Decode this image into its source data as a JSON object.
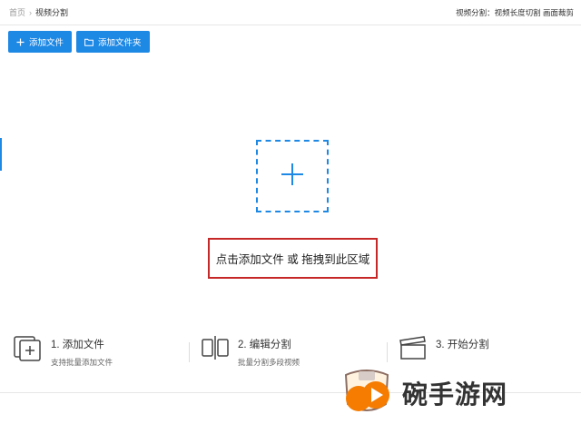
{
  "breadcrumb": {
    "home": "首页",
    "current": "视频分割"
  },
  "header_hint": "视频分割：视频长度切割 画面裁剪",
  "toolbar": {
    "add_file": "添加文件",
    "add_folder": "添加文件夹"
  },
  "drop_prompt": "点击添加文件 或 拖拽到此区域",
  "steps": [
    {
      "title": "1. 添加文件",
      "desc": "支持批量添加文件",
      "icon": "add-files-icon"
    },
    {
      "title": "2. 编辑分割",
      "desc": "批量分割多段视频",
      "icon": "split-icon"
    },
    {
      "title": "3. 开始分割",
      "desc": "",
      "icon": "clapperboard-icon"
    }
  ],
  "watermark": {
    "text": "碗手游网"
  },
  "colors": {
    "accent": "#1e88e5",
    "highlight_border": "#c62828",
    "watermark_orange": "#f57c00"
  }
}
